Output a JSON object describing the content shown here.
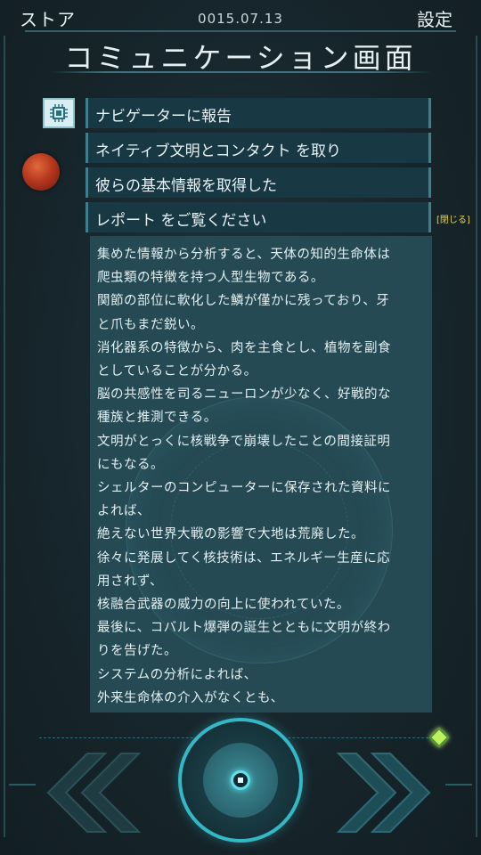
{
  "topbar": {
    "store_label": "ストア",
    "date": "0015.07.13",
    "settings_label": "設定"
  },
  "title": "コミュニケーション画面",
  "messages": [
    "ナビゲーターに報告",
    "ネイティブ文明とコンタクト を取り",
    "彼らの基本情報を取得した",
    "レポート をご覧ください"
  ],
  "close_label": "[閉じる]",
  "report_lines": [
    "集めた情報から分析すると、天体の知的生命体は",
    "爬虫類の特徴を持つ人型生物である。",
    "関節の部位に軟化した鱗が僅かに残っており、牙",
    "と爪もまだ鋭い。",
    "消化器系の特徴から、肉を主食とし、植物を副食",
    "としていることが分かる。",
    "脳の共感性を司るニューロンが少なく、好戦的な",
    "種族と推測できる。",
    "文明がとっくに核戦争で崩壊したことの間接証明",
    "にもなる。",
    "シェルターのコンピューターに保存された資料に",
    "よれば、",
    "絶えない世界大戦の影響で大地は荒廃した。",
    "徐々に発展してく核技術は、エネルギー生産に応",
    "用されず、",
    "核融合武器の威力の向上に使われていた。",
    "最後に、コバルト爆弾の誕生とともに文明が終わ",
    "りを告げた。",
    "システムの分析によれば、",
    "外来生命体の介入がなくとも、"
  ],
  "colors": {
    "background": "#17262c",
    "panel": "#254a54",
    "message_bg": "#183843",
    "accent": "#34b7c6",
    "close_link": "#e7d44a",
    "gem": "#bff25a"
  },
  "icons": {
    "navigator_avatar": "chip-icon",
    "planet": "planet-icon",
    "prev": "double-chevron-left-icon",
    "next": "double-chevron-right-icon",
    "center": "ring-button-icon",
    "gem": "diamond-gem-icon"
  }
}
